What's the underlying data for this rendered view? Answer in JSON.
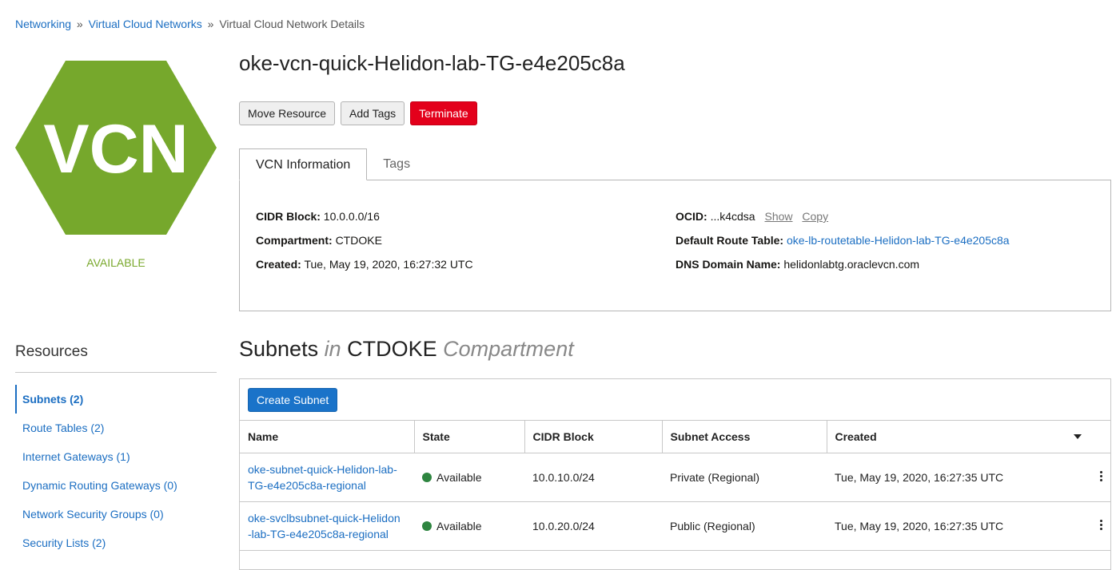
{
  "breadcrumb": {
    "items": [
      {
        "label": "Networking"
      },
      {
        "label": "Virtual Cloud Networks"
      },
      {
        "label": "Virtual Cloud Network Details"
      }
    ],
    "separator": "»"
  },
  "vcn_badge": {
    "text": "VCN",
    "status": "AVAILABLE",
    "color": "#76a82c"
  },
  "title": "oke-vcn-quick-Helidon-lab-TG-e4e205c8a",
  "actions": {
    "move_label": "Move Resource",
    "tags_label": "Add Tags",
    "terminate_label": "Terminate"
  },
  "tabs": [
    {
      "label": "VCN Information",
      "active": true
    },
    {
      "label": "Tags",
      "active": false
    }
  ],
  "info": {
    "cidr_label": "CIDR Block:",
    "cidr_value": "10.0.0.0/16",
    "compartment_label": "Compartment:",
    "compartment_value": "CTDOKE",
    "created_label": "Created:",
    "created_value": "Tue, May 19, 2020, 16:27:32 UTC",
    "ocid_label": "OCID:",
    "ocid_value": "...k4cdsa",
    "ocid_show": "Show",
    "ocid_copy": "Copy",
    "route_label": "Default Route Table:",
    "route_value": "oke-lb-routetable-Helidon-lab-TG-e4e205c8a",
    "dns_label": "DNS Domain Name:",
    "dns_value": "helidonlabtg.oraclevcn.com"
  },
  "resources": {
    "title": "Resources",
    "items": [
      {
        "label": "Subnets (2)",
        "active": true
      },
      {
        "label": "Route Tables (2)"
      },
      {
        "label": "Internet Gateways (1)"
      },
      {
        "label": "Dynamic Routing Gateways (0)"
      },
      {
        "label": "Network Security Groups (0)"
      },
      {
        "label": "Security Lists (2)"
      }
    ]
  },
  "subnets": {
    "heading_main": "Subnets",
    "heading_in": "in",
    "heading_compartment": "CTDOKE",
    "heading_suffix": "Compartment",
    "create_label": "Create Subnet",
    "columns": [
      "Name",
      "State",
      "CIDR Block",
      "Subnet Access",
      "Created"
    ],
    "rows": [
      {
        "name_line1": "oke-subnet-quick-Helidon-lab-",
        "name_line2": "TG-e4e205c8a-regional",
        "state": "Available",
        "cidr": "10.0.10.0/24",
        "access": "Private (Regional)",
        "created": "Tue, May 19, 2020, 16:27:35 UTC"
      },
      {
        "name_line1": "oke-svclbsubnet-quick-Helidon",
        "name_line2": "-lab-TG-e4e205c8a-regional",
        "state": "Available",
        "cidr": "10.0.20.0/24",
        "access": "Public (Regional)",
        "created": "Tue, May 19, 2020, 16:27:35 UTC"
      }
    ]
  },
  "colors": {
    "link": "#1b6ec2",
    "terminate": "#e3001b",
    "primary": "#1a73c9",
    "available": "#2e8540",
    "status_green": "#79a82c"
  }
}
